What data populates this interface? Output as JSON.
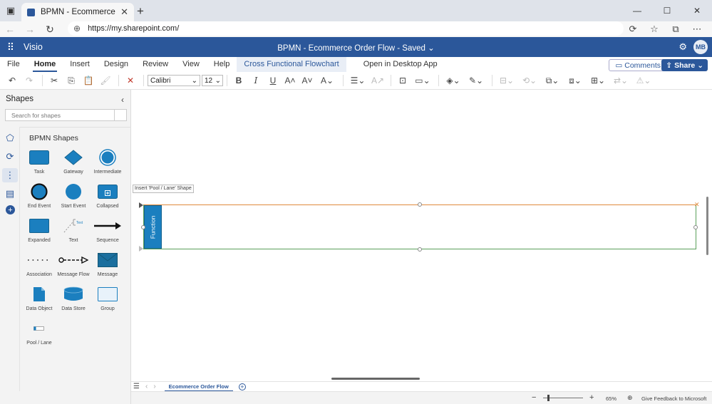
{
  "browser": {
    "tab_title": "BPMN - Ecommerce Order Flow",
    "url": "https://my.sharepoint.com/"
  },
  "app": {
    "name": "Visio",
    "doc_title": "BPMN - Ecommerce Order Flow - Saved",
    "user_initials": "MB"
  },
  "ribbon": {
    "tabs": [
      "File",
      "Home",
      "Insert",
      "Design",
      "Review",
      "View",
      "Help",
      "Cross Functional Flowchart"
    ],
    "open_desktop": "Open in Desktop App",
    "comments": "Comments",
    "share": "Share"
  },
  "toolbar": {
    "font": "Calibri",
    "size": "12"
  },
  "shapes_panel": {
    "title": "Shapes",
    "search_placeholder": "Search for shapes",
    "stencil_title": "BPMN Shapes",
    "shapes": [
      "Task",
      "Gateway",
      "Intermediate",
      "End Event",
      "Start Event",
      "Collapsed",
      "Expanded",
      "Text",
      "Sequence",
      "Association",
      "Message Flow",
      "Message",
      "Data Object",
      "Data Store",
      "Group",
      "Pool / Lane"
    ],
    "text_shape_label": "Text"
  },
  "canvas": {
    "tooltip": "Insert 'Pool / Lane' Shape",
    "lane_label": "Function"
  },
  "pages": {
    "active": "Ecommerce Order Flow"
  },
  "status": {
    "zoom": "65%",
    "feedback": "Give Feedback to Microsoft"
  },
  "colors": {
    "brand": "#2b579a",
    "shape_fill": "#1b7fbf",
    "pool_top": "#e08a3c",
    "pool_border": "#5aa05a"
  }
}
